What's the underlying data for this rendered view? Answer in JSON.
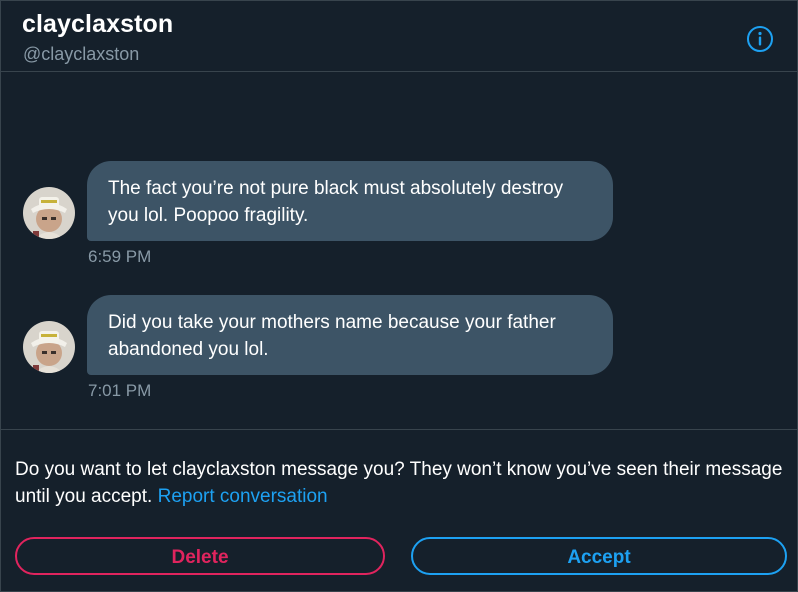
{
  "header": {
    "display_name": "clayclaxston",
    "handle": "@clayclaxston"
  },
  "messages": [
    {
      "text": "The fact you’re not pure black must absolutely destroy you lol. Poopoo fragility.",
      "time": "6:59 PM"
    },
    {
      "text": "Did you take your mothers name because your father abandoned you lol.",
      "time": "7:01 PM"
    }
  ],
  "request": {
    "prompt": "Do you want to let clayclaxston message you? They won’t know you’ve seen their message until you accept.",
    "report_link": "Report conversation"
  },
  "actions": {
    "delete_label": "Delete",
    "accept_label": "Accept"
  },
  "colors": {
    "background": "#15202b",
    "bubble": "#3d5466",
    "accent_blue": "#1da1f2",
    "danger_red": "#e0245e",
    "secondary_text": "#8899a6"
  },
  "icons": {
    "info": "info-icon",
    "avatar": "avatar"
  }
}
